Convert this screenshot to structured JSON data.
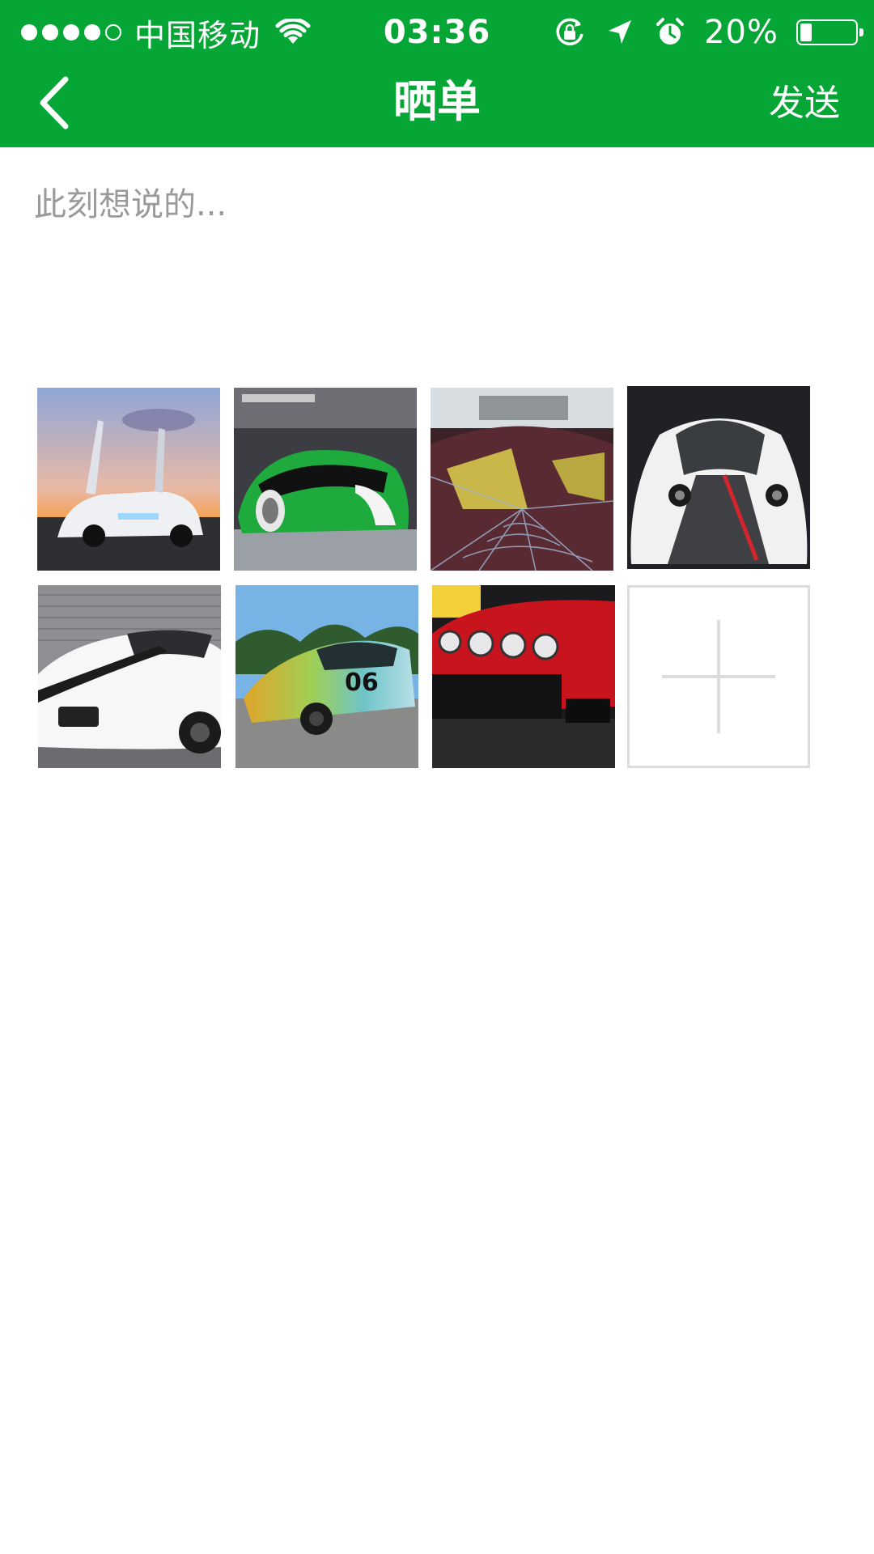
{
  "status_bar": {
    "signal_filled": 4,
    "signal_total": 5,
    "carrier": "中国移动",
    "time": "03:36",
    "battery_percent": "20%",
    "battery_level": 0.2,
    "icons": [
      "wifi-icon",
      "rotation-lock-icon",
      "location-arrow-icon",
      "alarm-icon",
      "battery-icon"
    ]
  },
  "nav": {
    "title": "晒单",
    "send_label": "发送",
    "back_icon": "chevron-left-icon"
  },
  "compose": {
    "placeholder": "此刻想说的...",
    "value": ""
  },
  "photos": [
    {
      "description": "white-sports-car-open-doors",
      "icon": "photo-thumbnail"
    },
    {
      "description": "green-concept-car",
      "icon": "photo-thumbnail"
    },
    {
      "description": "spider-web-painted-car",
      "icon": "photo-thumbnail"
    },
    {
      "description": "white-black-supercar",
      "icon": "photo-thumbnail"
    },
    {
      "description": "white-ferrari-stripes",
      "icon": "photo-thumbnail"
    },
    {
      "description": "multicolor-06-race-sedan",
      "icon": "photo-thumbnail"
    },
    {
      "description": "red-mitsubishi-rally-car",
      "icon": "photo-thumbnail"
    }
  ],
  "add_photo": {
    "icon": "plus-icon"
  },
  "colors": {
    "brand_green": "#05a636",
    "header_text": "#ffffff",
    "placeholder": "#9a9a9a",
    "tile_border": "#dcdcdc"
  }
}
